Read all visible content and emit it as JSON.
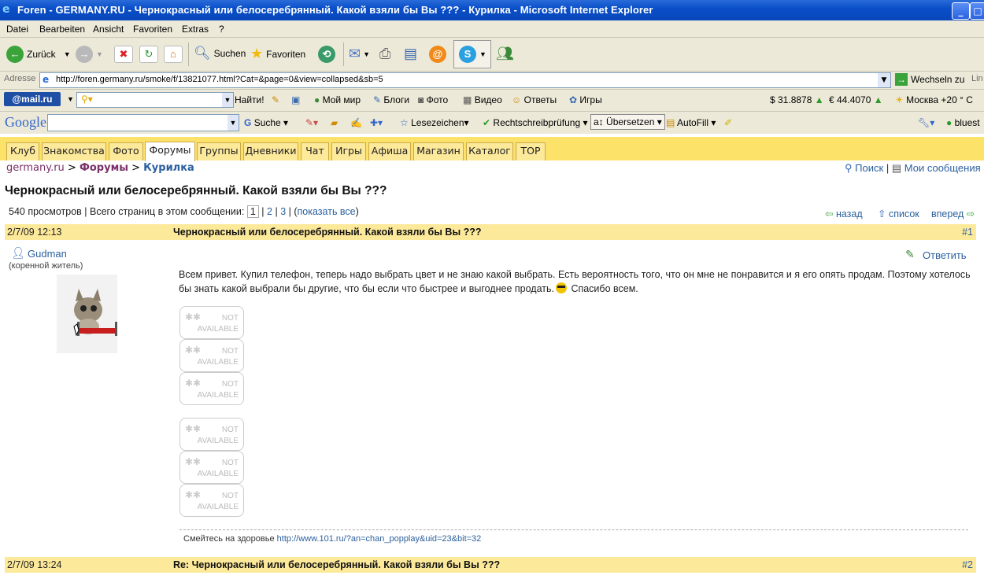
{
  "window": {
    "title": "Foren - GERMANY.RU - Чернокрасный или белосеребрянный. Какой взяли бы Вы ??? - Курилка - Microsoft Internet Explorer"
  },
  "menu": [
    "Datei",
    "Bearbeiten",
    "Ansicht",
    "Favoriten",
    "Extras",
    "?"
  ],
  "toolbar": {
    "back": "Zurück",
    "search": "Suchen",
    "favorites": "Favoriten"
  },
  "address": {
    "label": "Adresse",
    "url": "http://foren.germany.ru/smoke/f/13821077.html?Cat=&page=0&view=collapsed&sb=5",
    "go": "Wechseln zu",
    "links": "Lin"
  },
  "mailbar": {
    "logo": "@mail.ru",
    "find": "Найти!",
    "items": [
      "Мой мир",
      "Блоги",
      "Фото",
      "Видео",
      "Ответы",
      "Игры"
    ],
    "usd": "$ 31.8878",
    "eur": "€ 44.4070",
    "weather": "Москва +20 ° C"
  },
  "googlebar": {
    "logo": "Google",
    "search": "Suche",
    "bookmarks": "Lesezeichen",
    "spell": "Rechtschreibprüfung",
    "translate": "Übersetzen",
    "autofill": "AutoFill",
    "user": "bluest"
  },
  "tabs": [
    "Клуб",
    "Знакомства",
    "Фото",
    "Форумы",
    "Группы",
    "Дневники",
    "Чат",
    "Игры",
    "Афиша",
    "Магазин",
    "Каталог",
    "TOP"
  ],
  "breadcrumb": {
    "site": "germany.ru",
    "sep1": ">",
    "forums": "Форумы",
    "sep2": ">",
    "board": "Курилка"
  },
  "topright": {
    "search": "Поиск",
    "sep": "|",
    "my": "Мои сообщения"
  },
  "thread": {
    "title": "Чернокрасный или белосеребрянный. Какой взяли бы Вы ???",
    "views": "540 просмотров",
    "pages_label": "Всего страниц в этом сообщении:",
    "pages": [
      "1",
      "2",
      "3"
    ],
    "show_all": "показать все",
    "nav": {
      "back": "назад",
      "list": "список",
      "forward": "вперед"
    }
  },
  "post1": {
    "date": "2/7/09 12:13",
    "title": "Чернокрасный или белосеребрянный. Какой взяли бы Вы ???",
    "num": "#1",
    "author": "Gudman",
    "status": "(коренной житель)",
    "reply": "Ответить",
    "text1": "Всем привет. Купил телефон, теперь надо выбрать цвет и не знаю какой выбрать. Есть вероятность того, что он мне не понравится и я его опять продам. Поэтому хотелось бы знать какой выбрали бы другие, что бы если что быстрее и выгоднее продать.",
    "text2": "Спасибо всем.",
    "na": [
      "NOT",
      "AVAILABLE"
    ],
    "sig_text": "Смейтесь на здоровье",
    "sig_link": "http://www.101.ru/?an=chan_popplay&uid=23&bit=32"
  },
  "post2": {
    "date": "2/7/09 13:24",
    "title": "Re: Чернокрасный или белосеребрянный. Какой взяли бы Вы ???",
    "num": "#2"
  }
}
